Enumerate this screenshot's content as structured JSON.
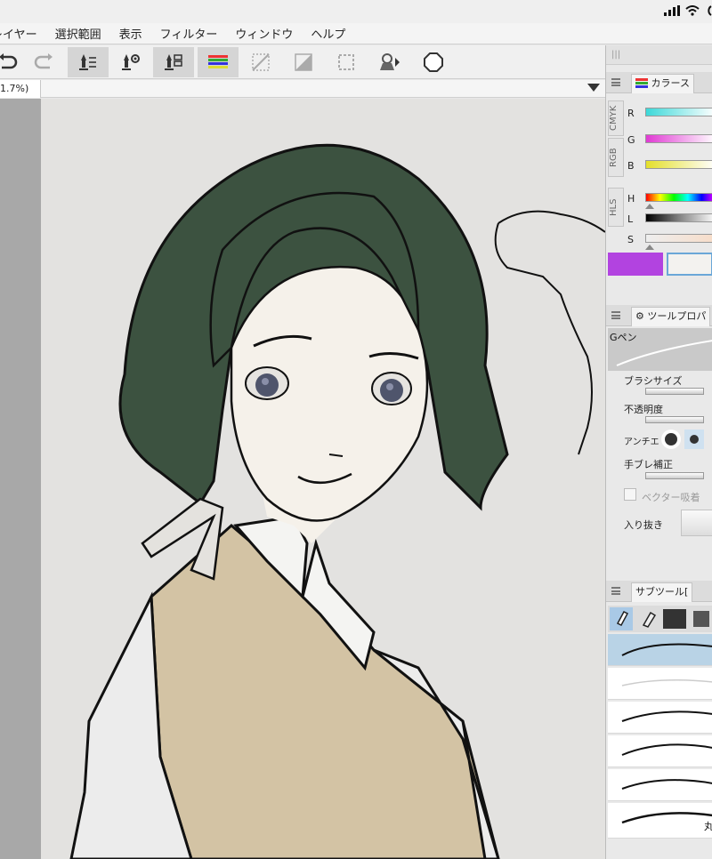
{
  "status_bar": {
    "signal": "signal-icon",
    "wifi": "wifi-icon",
    "battery_partial": "battery-icon"
  },
  "menu": {
    "items": [
      {
        "label": "レイヤー"
      },
      {
        "label": "選択範囲"
      },
      {
        "label": "表示"
      },
      {
        "label": "フィルター"
      },
      {
        "label": "ウィンドウ"
      },
      {
        "label": "ヘルプ"
      }
    ]
  },
  "toolbar": {
    "buttons": [
      "undo-icon",
      "redo-icon",
      "pen-layer-icon",
      "pen-settings-icon",
      "layer-list-icon",
      "color-set-icon",
      "transparent-icon",
      "fill-icon",
      "selection-icon",
      "reference-icon",
      "octagon-icon"
    ]
  },
  "document_tab": {
    "label": "1.7%)"
  },
  "panels": {
    "color": {
      "tab_label": "カラース",
      "vertical_tabs": [
        "CMYK",
        "RGB",
        "HLS"
      ],
      "rgb_labels": [
        "R",
        "G",
        "B"
      ],
      "hls_labels": [
        "H",
        "L",
        "S"
      ],
      "main_color": "#b243e0",
      "sub_color": "#f3f2ef"
    },
    "tool_property": {
      "tab_label": "ツールプロパ",
      "brush_name": "Gペン",
      "brush_size_label": "ブラシサイズ",
      "opacity_label": "不透明度",
      "antialias_label": "アンチエ",
      "stabilization_label": "手ブレ補正",
      "vector_snap_label": "ベクター吸着",
      "taper_label": "入り抜き"
    },
    "sub_tool": {
      "tab_label": "サブツール[",
      "last_brush_label": "丸"
    }
  }
}
